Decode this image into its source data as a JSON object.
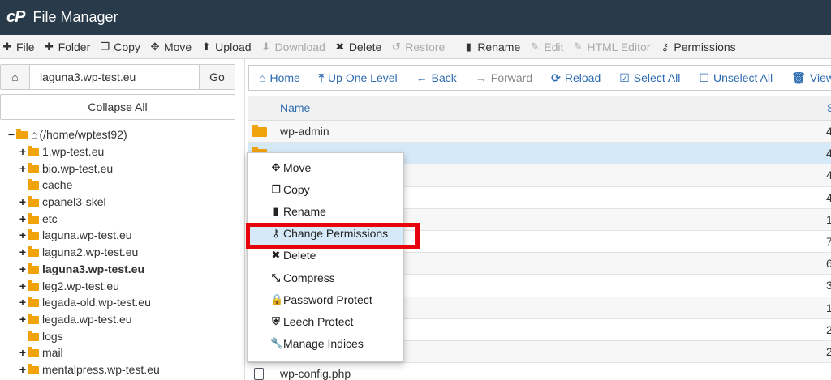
{
  "header": {
    "logo": "cP",
    "title": "File Manager"
  },
  "toolbar": [
    {
      "icon": "✚",
      "label": "File",
      "disabled": false,
      "name": "new-file-button",
      "icon_name": "plus-icon"
    },
    {
      "icon": "✚",
      "label": "Folder",
      "disabled": false,
      "name": "new-folder-button",
      "icon_name": "plus-icon"
    },
    {
      "icon": "❐",
      "label": "Copy",
      "disabled": false,
      "name": "copy-button",
      "icon_name": "copy-icon"
    },
    {
      "icon": "✥",
      "label": "Move",
      "disabled": false,
      "name": "move-button",
      "icon_name": "move-arrows-icon"
    },
    {
      "icon": "⬆",
      "label": "Upload",
      "disabled": false,
      "name": "upload-button",
      "icon_name": "upload-icon"
    },
    {
      "icon": "⬇",
      "label": "Download",
      "disabled": true,
      "name": "download-button",
      "icon_name": "download-icon"
    },
    {
      "icon": "✖",
      "label": "Delete",
      "disabled": false,
      "name": "delete-button",
      "icon_name": "x-icon"
    },
    {
      "icon": "↺",
      "label": "Restore",
      "disabled": true,
      "name": "restore-button",
      "icon_name": "undo-icon"
    },
    {
      "sep": true
    },
    {
      "icon": "▮",
      "label": "Rename",
      "disabled": false,
      "name": "rename-button",
      "icon_name": "file-icon"
    },
    {
      "icon": "✎",
      "label": "Edit",
      "disabled": true,
      "name": "edit-button",
      "icon_name": "pencil-icon"
    },
    {
      "icon": "✎",
      "label": "HTML Editor",
      "disabled": true,
      "name": "html-editor-button",
      "icon_name": "edit-square-icon"
    },
    {
      "icon": "⚷",
      "label": "Permissions",
      "disabled": false,
      "name": "permissions-button",
      "icon_name": "key-icon"
    }
  ],
  "left": {
    "path_value": "laguna3.wp-test.eu",
    "go_label": "Go",
    "collapse_label": "Collapse All",
    "tree": [
      {
        "exp": "−",
        "label": "(/home/wptest92)",
        "root": true
      },
      {
        "exp": "+",
        "label": "1.wp-test.eu"
      },
      {
        "exp": "+",
        "label": "bio.wp-test.eu"
      },
      {
        "exp": "",
        "label": "cache"
      },
      {
        "exp": "+",
        "label": "cpanel3-skel"
      },
      {
        "exp": "+",
        "label": "etc"
      },
      {
        "exp": "+",
        "label": "laguna.wp-test.eu"
      },
      {
        "exp": "+",
        "label": "laguna2.wp-test.eu"
      },
      {
        "exp": "+",
        "label": "laguna3.wp-test.eu",
        "bold": true
      },
      {
        "exp": "+",
        "label": "leg2.wp-test.eu"
      },
      {
        "exp": "+",
        "label": "legada-old.wp-test.eu"
      },
      {
        "exp": "+",
        "label": "legada.wp-test.eu"
      },
      {
        "exp": "",
        "label": "logs"
      },
      {
        "exp": "+",
        "label": "mail"
      },
      {
        "exp": "+",
        "label": "mentalpress.wp-test.eu"
      }
    ]
  },
  "actions": [
    {
      "icon": "⌂",
      "label": "Home",
      "disabled": false,
      "name": "home-button",
      "icon_name": "home-icon"
    },
    {
      "icon": "⤒",
      "label": "Up One Level",
      "disabled": false,
      "name": "up-one-level-button",
      "icon_name": "level-up-icon"
    },
    {
      "icon": "←",
      "label": "Back",
      "disabled": false,
      "name": "back-button",
      "icon_name": "arrow-left-icon"
    },
    {
      "icon": "→",
      "label": "Forward",
      "disabled": true,
      "name": "forward-button",
      "icon_name": "arrow-right-icon"
    },
    {
      "icon": "⟳",
      "label": "Reload",
      "disabled": false,
      "name": "reload-button",
      "icon_name": "refresh-icon"
    },
    {
      "icon": "☑",
      "label": "Select All",
      "disabled": false,
      "name": "select-all-button",
      "icon_name": "checkbox-checked-icon"
    },
    {
      "icon": "☐",
      "label": "Unselect All",
      "disabled": false,
      "name": "unselect-all-button",
      "icon_name": "checkbox-empty-icon"
    },
    {
      "icon": "🗑",
      "label": "View T",
      "disabled": false,
      "name": "view-trash-button",
      "icon_name": "trash-icon"
    }
  ],
  "table": {
    "col_name": "Name",
    "col_size": "S",
    "rows": [
      {
        "name": "wp-admin",
        "type": "folder",
        "size": "4"
      },
      {
        "name": "",
        "type": "folder",
        "size": "4",
        "selected": true
      },
      {
        "name": "",
        "type": "folder",
        "size": "4"
      },
      {
        "name": "",
        "type": "file",
        "size": "4"
      },
      {
        "name": "",
        "type": "purple",
        "size": "1"
      },
      {
        "name": "",
        "type": "file",
        "size": "7"
      },
      {
        "name": "",
        "type": "file",
        "size": "6"
      },
      {
        "name": "",
        "type": "file",
        "size": "3"
      },
      {
        "name": "",
        "type": "file",
        "size": "1"
      },
      {
        "name": "",
        "type": "file",
        "size": "2"
      },
      {
        "name": "",
        "type": "file",
        "size": "2"
      },
      {
        "name": "wp-config.php",
        "type": "file",
        "size": ""
      }
    ]
  },
  "context_menu": [
    {
      "icon": "✥",
      "label": "Move",
      "name": "ctx-move",
      "icon_name": "move-arrows-icon"
    },
    {
      "icon": "❐",
      "label": "Copy",
      "name": "ctx-copy",
      "icon_name": "copy-icon"
    },
    {
      "icon": "▮",
      "label": "Rename",
      "name": "ctx-rename",
      "icon_name": "file-icon"
    },
    {
      "icon": "⚷",
      "label": "Change Permissions",
      "name": "ctx-change-permissions",
      "icon_name": "key-icon",
      "hover": true
    },
    {
      "icon": "✖",
      "label": "Delete",
      "name": "ctx-delete",
      "icon_name": "x-icon"
    },
    {
      "icon": "⤡",
      "label": "Compress",
      "name": "ctx-compress",
      "icon_name": "compress-icon"
    },
    {
      "icon": "🔒",
      "label": "Password Protect",
      "name": "ctx-password-protect",
      "icon_name": "lock-icon"
    },
    {
      "icon": "⛨",
      "label": "Leech Protect",
      "name": "ctx-leech-protect",
      "icon_name": "shield-icon"
    },
    {
      "icon": "🔧",
      "label": "Manage Indices",
      "name": "ctx-manage-indices",
      "icon_name": "wrench-icon"
    }
  ],
  "colors": {
    "header_bg": "#293a4a",
    "link": "#2c6bb0",
    "highlight": "#e8000b",
    "folder": "#f0a30a",
    "selected_row": "#d6e9f8"
  }
}
